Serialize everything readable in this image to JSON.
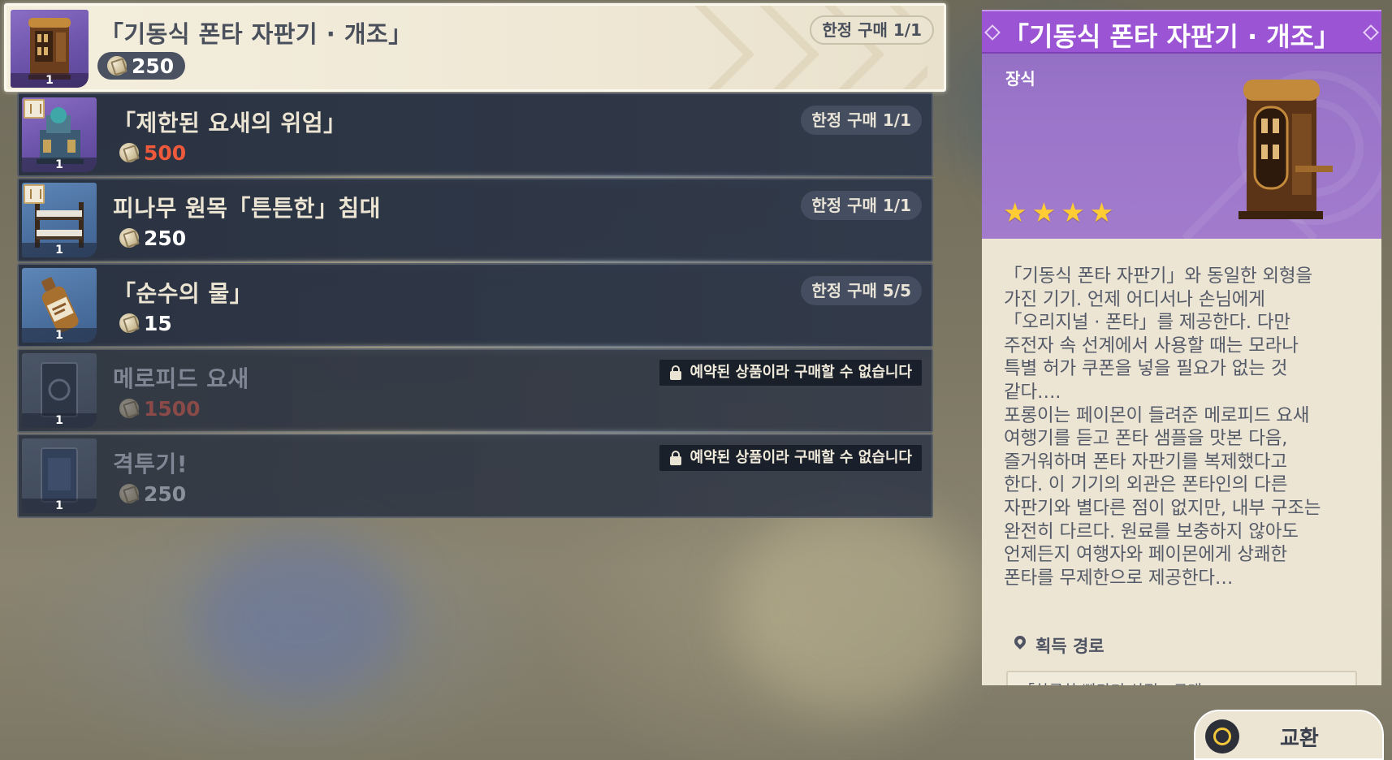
{
  "shop": {
    "items": [
      {
        "name": "「기동식 폰타 자판기 · 개조」",
        "price": "250",
        "limit": "한정 구매 1/1",
        "count": "1",
        "state": "selected"
      },
      {
        "name": "「제한된 요새의 위엄」",
        "price": "500",
        "limit": "한정 구매 1/1",
        "count": "1",
        "state": "insufficient"
      },
      {
        "name": "피나무 원목「튼튼한」침대",
        "price": "250",
        "limit": "한정 구매 1/1",
        "count": "1",
        "state": "normal"
      },
      {
        "name": "「순수의 물」",
        "price": "15",
        "limit": "한정 구매 5/5",
        "count": "1",
        "state": "normal"
      },
      {
        "name": "메로피드 요새",
        "price": "1500",
        "reserved": "예약된 상품이라 구매할 수 없습니다",
        "count": "1",
        "state": "reserved"
      },
      {
        "name": "격투기!",
        "price": "250",
        "reserved": "예약된 상품이라 구매할 수 없습니다",
        "count": "1",
        "state": "reserved"
      }
    ]
  },
  "detail": {
    "title": "「기동식 폰타 자판기 · 개조」",
    "type": "장식",
    "rarity": 4,
    "description": "「기동식 폰타 자판기」와 동일한 외형을\n가진 기기. 언제 어디서나 손님에게\n「오리지널 · 폰타」를 제공한다. 다만\n주전자 속 선계에서 사용할 때는 모라나\n특별 허가 쿠폰을 넣을 필요가 없는 것\n같다….\n포롱이는 페이몬이 들려준 메로피드 요새\n여행기를 듣고 폰타 샘플을 맛본 다음,\n즐거워하며 폰타 자판기를 복제했다고\n한다. 이 기기의 외관은 폰타인의 다른\n자판기와 별다른 점이 없지만, 내부 구조는\n완전히 다르다. 원료를 보충하지 않아도\n언제든지 여행자와 페이몬에게 상쾌한\n폰타를 무제한으로 제공한다…",
    "source_label": "획득 경로",
    "source_value": "「하루하 빵타기 상점」구매"
  },
  "exchange_button": {
    "label": "교환"
  },
  "colors": {
    "price_red": "#f05a3c",
    "rarity_purple": "#9a54d4",
    "star": "#ffcc33"
  }
}
